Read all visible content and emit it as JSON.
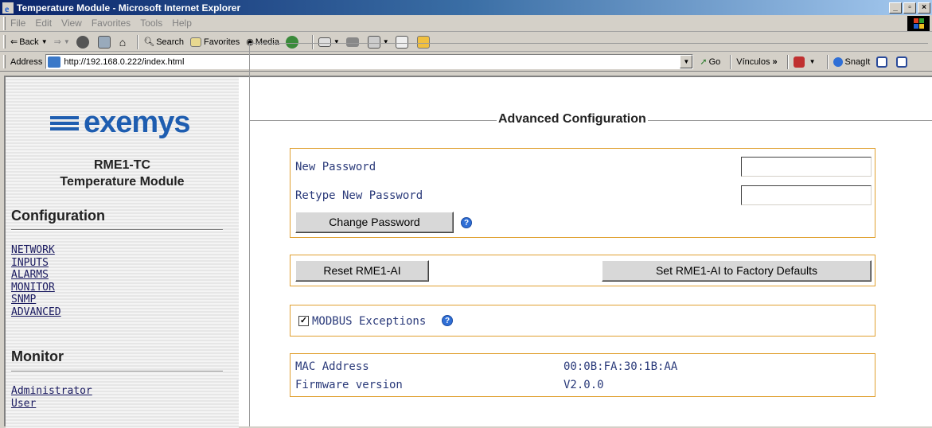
{
  "window": {
    "title": "Temperature Module - Microsoft Internet Explorer"
  },
  "menu": [
    "File",
    "Edit",
    "View",
    "Favorites",
    "Tools",
    "Help"
  ],
  "toolbar": {
    "back": "Back",
    "search": "Search",
    "favorites": "Favorites",
    "media": "Media"
  },
  "address": {
    "label": "Address",
    "url": "http://192.168.0.222/index.html",
    "go": "Go",
    "links": "Vínculos",
    "snagit": "SnagIt"
  },
  "sidebar": {
    "brand": "exemys",
    "model": "RME1-TC",
    "model_desc": "Temperature Module",
    "config_title": "Configuration",
    "config_links": [
      "NETWORK",
      "INPUTS",
      "ALARMS",
      "MONITOR",
      "SNMP",
      "ADVANCED"
    ],
    "monitor_title": "Monitor",
    "monitor_links": [
      "Administrator",
      "User"
    ]
  },
  "main": {
    "legend": "Advanced Configuration",
    "password": {
      "new_label": "New Password",
      "new_value": "",
      "retype_label": "Retype New Password",
      "retype_value": "",
      "change_button": "Change Password"
    },
    "reset_button": "Reset RME1-AI",
    "factory_button": "Set RME1-AI to Factory Defaults",
    "modbus": {
      "label": "MODBUS Exceptions",
      "checked": true
    },
    "info": {
      "mac_label": "MAC Address",
      "mac_value": "00:0B:FA:30:1B:AA",
      "fw_label": "Firmware version",
      "fw_value": "V2.0.0"
    }
  },
  "colors": {
    "brand_blue": "#1e5db0",
    "box_border": "#e0a030",
    "help_icon": "#2f6fd6"
  }
}
